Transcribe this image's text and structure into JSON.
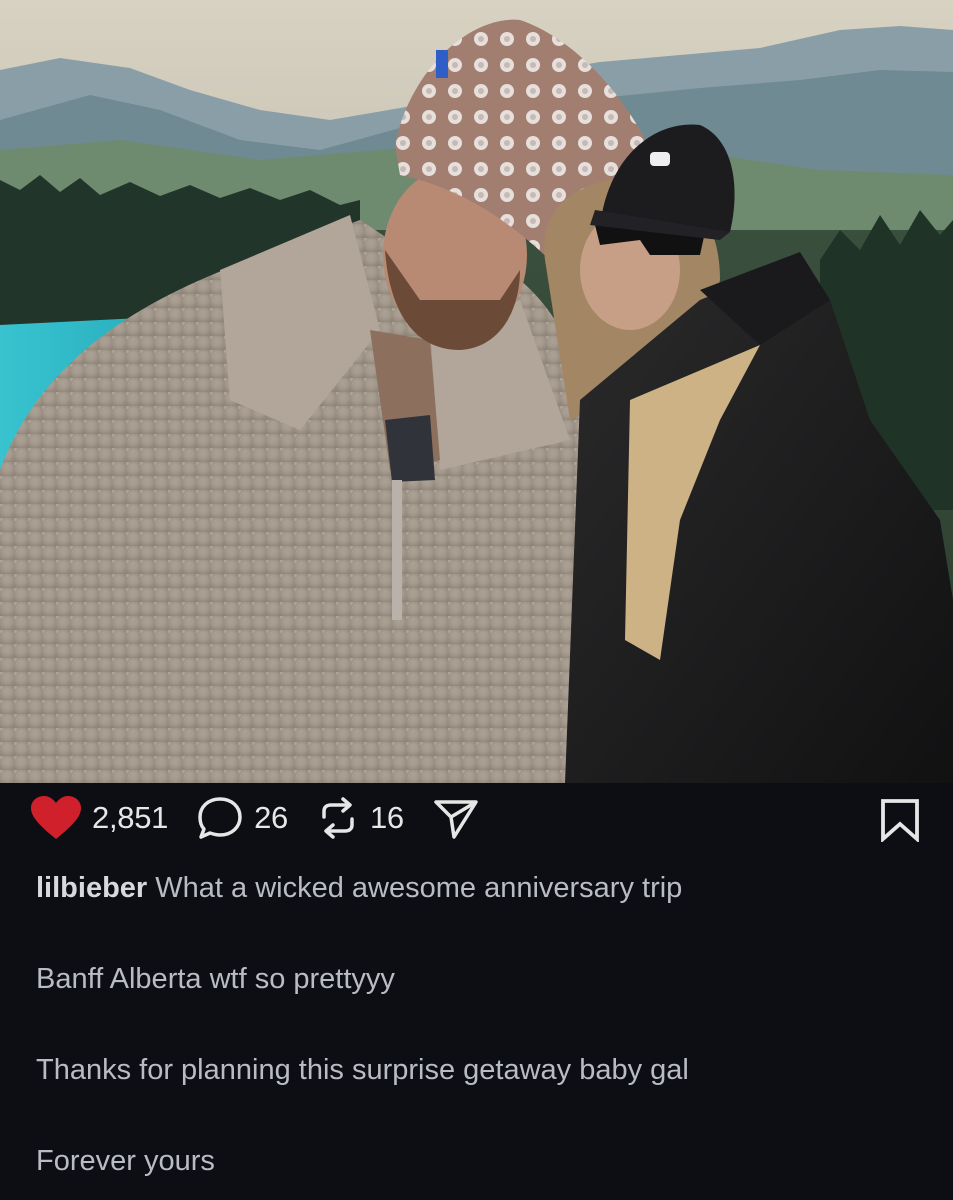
{
  "post": {
    "photo_alt": "",
    "likes_count": "2,851",
    "comments_count": "26",
    "reposts_count": "16",
    "like_color": "#d0202b",
    "icons": [
      "heart-icon",
      "comment-icon",
      "repost-icon",
      "share-icon",
      "bookmark-icon"
    ]
  },
  "caption": {
    "username": "lilbieber",
    "first_line": "What a wicked awesome anniversary trip",
    "lines": [
      "Banff Alberta wtf so prettyyy",
      "Thanks for planning this surprise getaway baby gal",
      "Forever yours"
    ]
  }
}
